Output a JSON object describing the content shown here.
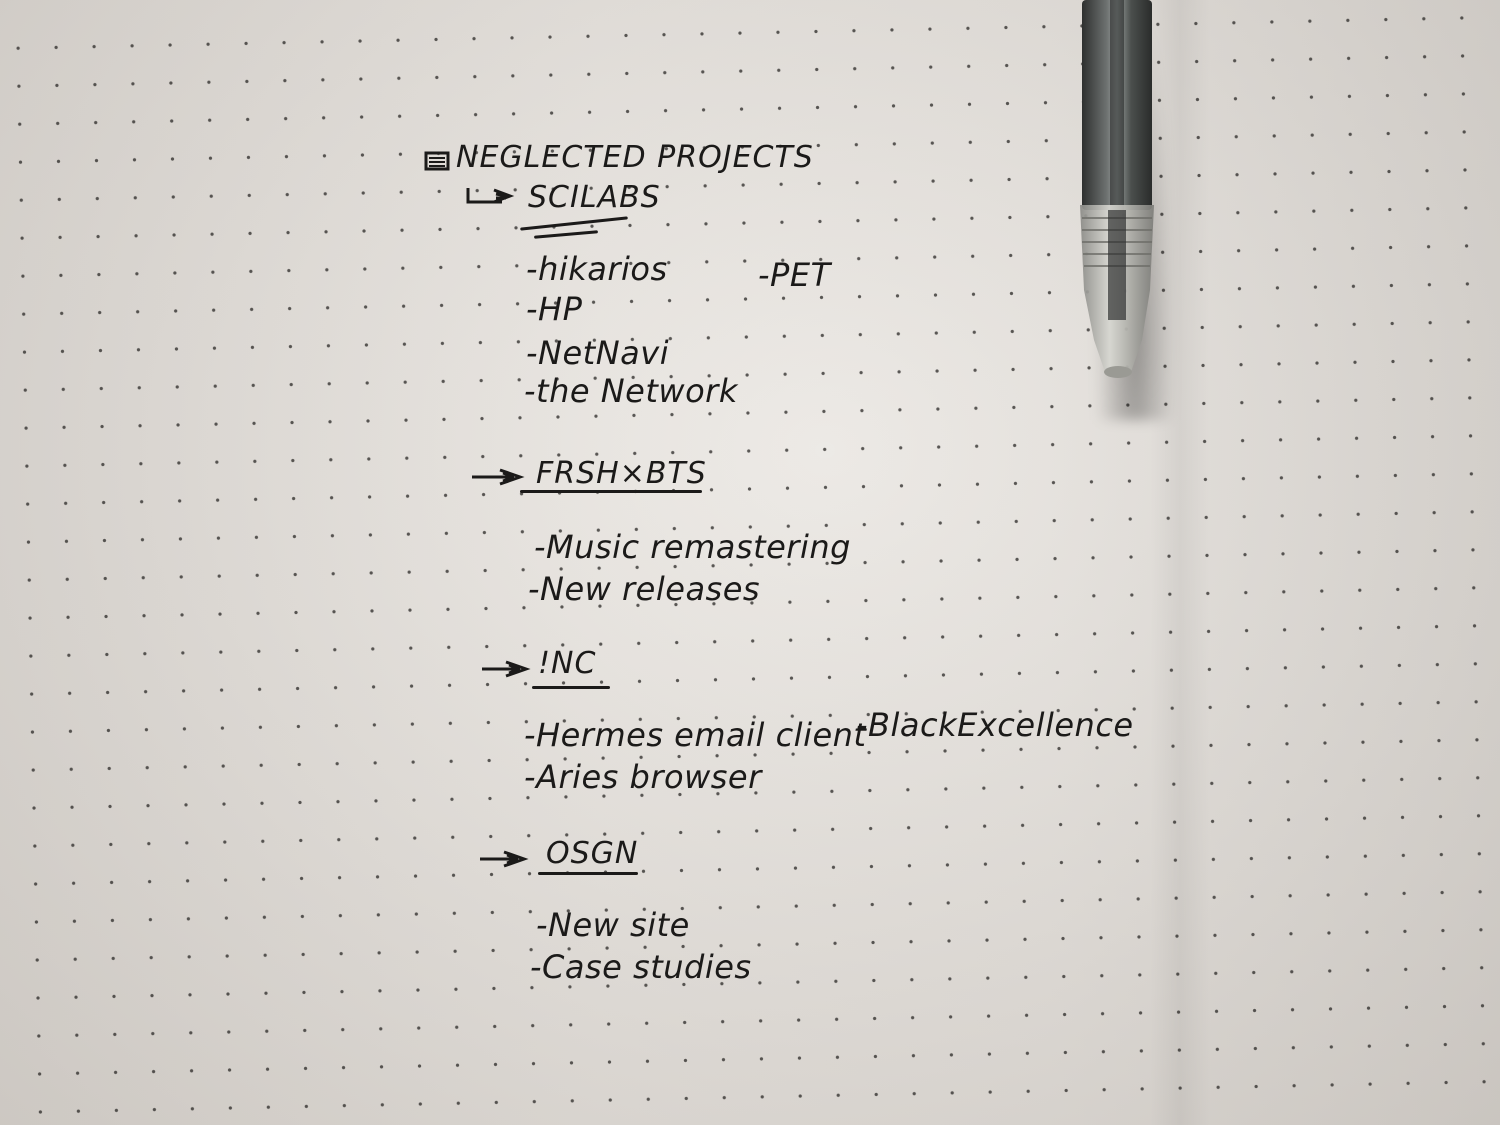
{
  "notebook": {
    "title": "NEGLECTED PROJECTS",
    "sections": [
      {
        "heading": "SCILABS",
        "items": [
          "-hikarios",
          "-HP",
          "-NetNavi",
          "-the Network"
        ],
        "aside": "-PET"
      },
      {
        "heading": "FRSH×BTS",
        "items": [
          "-Music remastering",
          "-New releases"
        ]
      },
      {
        "heading": "!NC",
        "items": [
          "-Hermes email client",
          "-Aries browser"
        ],
        "aside": "-BlackExcellence"
      },
      {
        "heading": "OSGN",
        "items": [
          "-New site",
          "-Case studies"
        ]
      }
    ]
  },
  "colors": {
    "paper": "#ece9e5",
    "ink": "#1b1a19",
    "pen_body": "#4a4d4c"
  },
  "icons": [
    "checkbox-icon",
    "arrow-bullet-icon",
    "pen"
  ]
}
